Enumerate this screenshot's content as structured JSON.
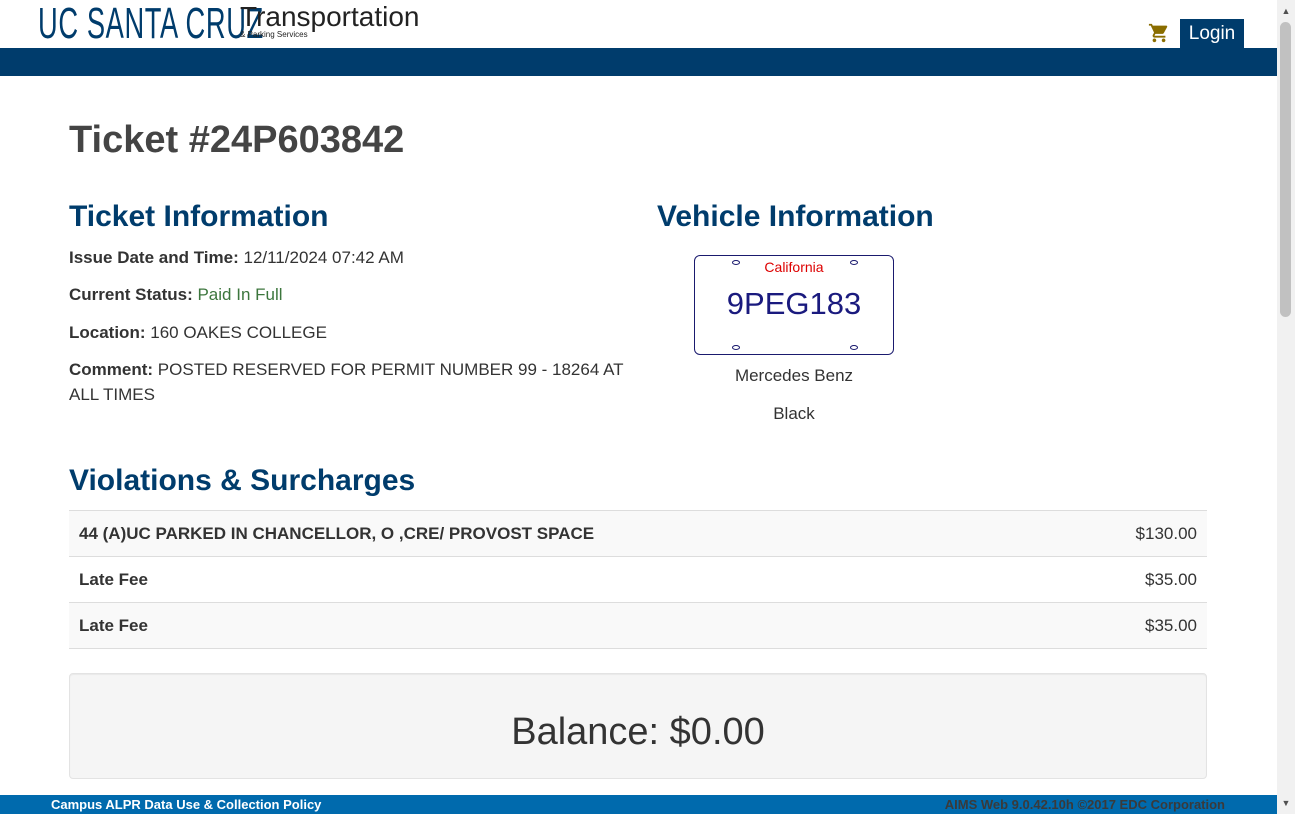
{
  "header": {
    "logo_main": "UC SANTA CRUZ",
    "logo_transport": "Transportation",
    "logo_parking": "& Parking Services",
    "cart_icon": "shopping-cart-icon",
    "login_label": "Login"
  },
  "ticket": {
    "title": "Ticket #24P603842"
  },
  "ticket_info": {
    "heading": "Ticket Information",
    "issue_label": "Issue Date and Time:",
    "issue_value": "12/11/2024 07:42 AM",
    "status_label": "Current Status:",
    "status_value": "Paid In Full",
    "location_label": "Location:",
    "location_value": "160 OAKES COLLEGE",
    "comment_label": "Comment:",
    "comment_value": "POSTED RESERVED FOR PERMIT NUMBER 99 - 18264 AT ALL TIMES"
  },
  "vehicle_info": {
    "heading": "Vehicle Information",
    "plate_state": "California",
    "plate_number": "9PEG183",
    "make": "Mercedes Benz",
    "color": "Black"
  },
  "violations": {
    "heading": "Violations & Surcharges",
    "rows": [
      {
        "description": "44 (A)UC PARKED IN CHANCELLOR, O ,CRE/ PROVOST SPACE",
        "amount": "$130.00"
      },
      {
        "description": "Late Fee",
        "amount": "$35.00"
      },
      {
        "description": "Late Fee",
        "amount": "$35.00"
      }
    ]
  },
  "balance": {
    "text": "Balance: $0.00"
  },
  "footer": {
    "policy_link": "Campus ALPR Data Use & Collection Policy",
    "version": "AIMS Web 9.0.42.10h ©2017 EDC Corporation"
  },
  "colors": {
    "brand_navy": "#003c6c",
    "footer_blue": "#006aad",
    "status_green": "#3c763d",
    "plate_red": "#dd0000",
    "plate_blue": "#1a1a7e",
    "cart_gold": "#8a6d00"
  }
}
